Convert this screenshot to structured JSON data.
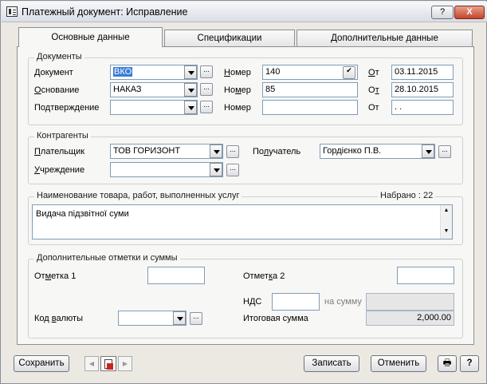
{
  "window": {
    "title": "Платежный документ: Исправление",
    "help": "?",
    "close": "X"
  },
  "tabs": [
    {
      "label": "Основные данные"
    },
    {
      "label": "Спецификации"
    },
    {
      "label": "Дополнительные данные"
    }
  ],
  "documents": {
    "legend": "Документы",
    "doc_label": "Документ",
    "doc_value": "ВКО",
    "basis_label": "Основание",
    "basis_value": "НАКАЗ",
    "confirm_label": "Подтверждение",
    "confirm_value": "",
    "number_label": "Номер",
    "number1": "140",
    "number2": "85",
    "number3": "",
    "from_label": "От",
    "date1": "03.11.2015",
    "date2": "28.10.2015",
    "date3": " . ."
  },
  "counterparties": {
    "legend": "Контрагенты",
    "payer_label": "Плательщик",
    "payer_value": "ТОВ ГОРИЗОНТ",
    "institution_label": "Учреждение",
    "institution_value": "",
    "recipient_label": "Получатель",
    "recipient_value": "Гордієнко П.В."
  },
  "goods": {
    "legend": "Наименование товара, работ, выполненных услуг",
    "typed": "Набрано : 22",
    "text": "Видача підзвітної суми"
  },
  "extra": {
    "legend": "Дополнительные отметки и суммы",
    "mark1_label": "Отметка 1",
    "mark2_label": "Отметка 2",
    "vat_label": "НДС",
    "on_sum_label": "на сумму",
    "currency_label": "Код валюты",
    "total_label": "Итоговая сумма",
    "total_value": "2,000.00"
  },
  "buttons": {
    "save": "Сохранить",
    "write": "Записать",
    "cancel": "Отменить",
    "help": "?"
  }
}
